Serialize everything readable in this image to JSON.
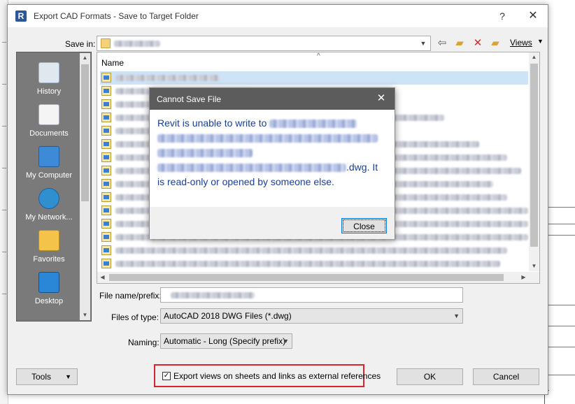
{
  "dialog": {
    "title": "Export CAD Formats - Save to Target Folder",
    "help_glyph": "?",
    "close_glyph": "✕",
    "app_icon_letter": "R"
  },
  "save_in": {
    "label": "Save in:",
    "views_label": "Views"
  },
  "places": [
    {
      "label": "History",
      "icon": "history-icon",
      "color": "#dfe7ef"
    },
    {
      "label": "Documents",
      "icon": "documents-icon",
      "color": "#f4f4f4"
    },
    {
      "label": "My Computer",
      "icon": "my-computer-icon",
      "color": "#3d8ad6"
    },
    {
      "label": "My Network...",
      "icon": "network-icon",
      "color": "#2f8fcf"
    },
    {
      "label": "Favorites",
      "icon": "favorites-icon",
      "color": "#f3c34a"
    },
    {
      "label": "Desktop",
      "icon": "desktop-icon",
      "color": "#2a86d6"
    }
  ],
  "file_list": {
    "column_name": "Name",
    "row_count": 16
  },
  "fields": {
    "file_name_label": "File name/prefix:",
    "files_of_type_label": "Files of type:",
    "files_of_type_value": "AutoCAD 2018 DWG Files  (*.dwg)",
    "naming_label": "Naming:",
    "naming_value": "Automatic - Long (Specify prefix)"
  },
  "bottom": {
    "tools_label": "Tools",
    "export_checkbox_label": "Export views on sheets and links as external references",
    "export_checked": true,
    "ok_label": "OK",
    "cancel_label": "Cancel",
    "highlight_color": "#d9232e"
  },
  "message_box": {
    "title": "Cannot Save File",
    "text_prefix": "Revit is unable to write to",
    "text_ext": ".dwg. It",
    "text_end": "is read-only or opened by someone else.",
    "close_label": "Close",
    "text_color": "#1b3f8f"
  }
}
